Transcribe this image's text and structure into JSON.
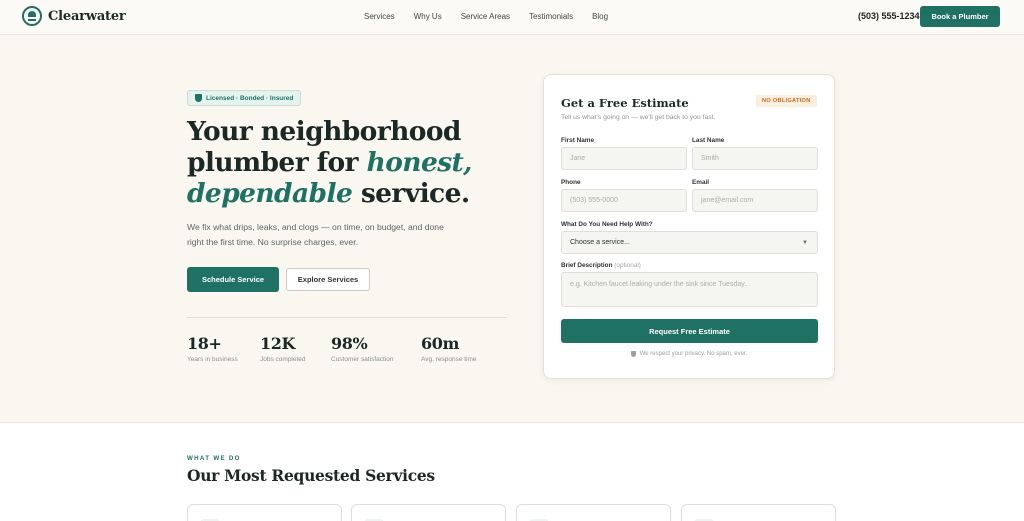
{
  "brand": {
    "name": "Clearwater",
    "color": "#1f7163"
  },
  "nav": {
    "links": [
      "Services",
      "Why Us",
      "Service Areas",
      "Testimonials",
      "Blog"
    ],
    "phone": "(503) 555-1234",
    "cta": "Book a Plumber"
  },
  "hero": {
    "badge": "Licensed · Bonded · Insured",
    "title_part1": "Your neighborhood plumber for ",
    "title_emphasis": "honest, dependable",
    "title_part2": " service.",
    "subtitle": "We fix what drips, leaks, and clogs — on time, on budget, and done right the first time. No surprise charges, ever.",
    "primary_cta": "Schedule Service",
    "secondary_cta": "Explore Services",
    "stats": [
      {
        "value": "18+",
        "label": "Years in business"
      },
      {
        "value": "12K",
        "label": "Jobs completed"
      },
      {
        "value": "98%",
        "label": "Customer satisfaction"
      },
      {
        "value": "60m",
        "label": "Avg. response time"
      }
    ]
  },
  "form": {
    "title": "Get a Free Estimate",
    "tag": "NO OBLIGATION",
    "subtitle": "Tell us what's going on — we'll get back to you fast.",
    "first_name": {
      "label": "First Name",
      "placeholder": "Jane"
    },
    "last_name": {
      "label": "Last Name",
      "placeholder": "Smith"
    },
    "phone": {
      "label": "Phone",
      "placeholder": "(503) 555-0000"
    },
    "email": {
      "label": "Email",
      "placeholder": "jane@email.com"
    },
    "help": {
      "label": "What Do You Need Help With?",
      "value": "Choose a service..."
    },
    "description": {
      "label": "Brief Description",
      "optional": "(optional)",
      "placeholder": "e.g. Kitchen faucet leaking under the sink since Tuesday..."
    },
    "submit": "Request Free Estimate",
    "privacy": "We respect your privacy. No spam, ever."
  },
  "services": {
    "eyebrow": "WHAT WE DO",
    "title": "Our Most Requested Services"
  }
}
